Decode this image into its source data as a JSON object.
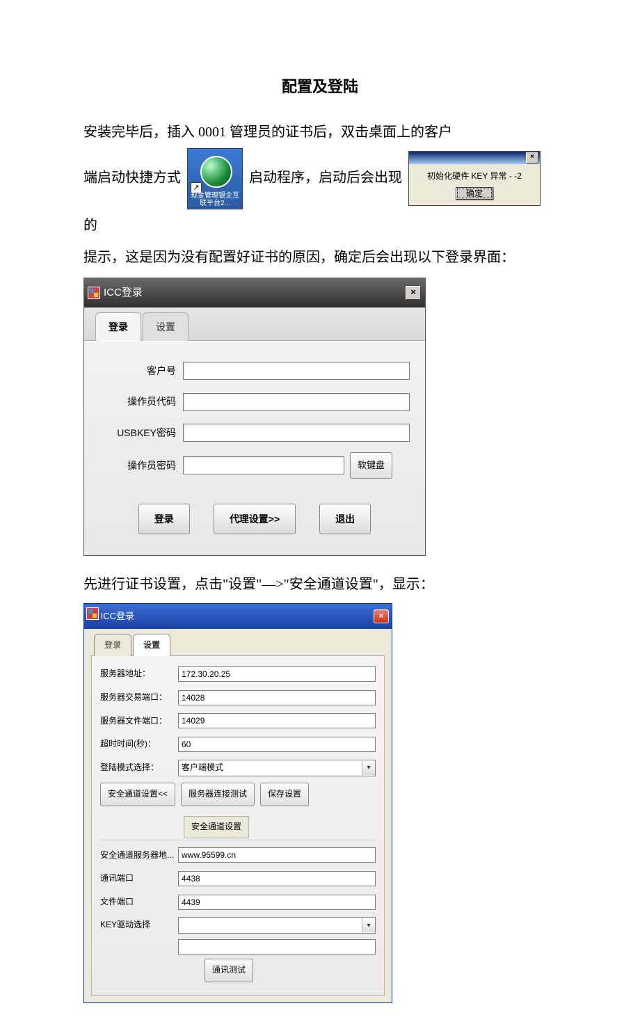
{
  "doc": {
    "title": "配置及登陆",
    "p1_a": "安装完毕后，插入 0001 管理员的证书后，双击桌面上的客户",
    "p1_b": "端启动快捷方式",
    "p1_c": "启动程序，启动后会出现",
    "p1_d": "的",
    "p2": "提示，这是因为没有配置好证书的原因，确定后会出现以下登录界面：",
    "p3": "先进行证书设置，点击\"设置\"—>\"安全通道设置\"，显示："
  },
  "shortcut": {
    "caption": "现金管理银企互联平台2...",
    "arrow_glyph": "↗"
  },
  "alert": {
    "msg": "初始化硬件 KEY 异常 - -2",
    "ok": "确定",
    "close": "×"
  },
  "login_win": {
    "title": "ICC登录",
    "close": "×",
    "tabs": {
      "login": "登录",
      "settings": "设置"
    },
    "fields": {
      "customer_no": "客户号",
      "operator_code": "操作员代码",
      "usbkey_pwd": "USBKEY密码",
      "operator_pwd": "操作员密码"
    },
    "soft_kb": "软键盘",
    "buttons": {
      "login": "登录",
      "proxy": "代理设置>>",
      "exit": "退出"
    }
  },
  "settings_win": {
    "title": "ICC登录",
    "close": "×",
    "tabs": {
      "login": "登录",
      "settings": "设置"
    },
    "fields": {
      "server_addr": "服务器地址：",
      "trade_port": "服务器交易端口：",
      "file_port": "服务器文件端口：",
      "timeout": "超时时间(秒)：",
      "login_mode": "登陆模式选择："
    },
    "values": {
      "server_addr": "172.30.20.25",
      "trade_port": "14028",
      "file_port": "14029",
      "timeout": "60",
      "login_mode": "客户端模式"
    },
    "buttons": {
      "sec_channel": "安全通道设置<<",
      "server_test": "服务器连接测试",
      "save": "保存设置",
      "comm_test": "通讯测试"
    },
    "sec_title": "安全通道设置",
    "sec_fields": {
      "sec_server": "安全通道服务器地...",
      "comm_port": "通讯端口",
      "file_port": "文件端口",
      "key_driver": "KEY驱动选择"
    },
    "sec_values": {
      "sec_server": "www.95599.cn",
      "comm_port": "4438",
      "file_port": "4439",
      "key_driver": ""
    }
  }
}
